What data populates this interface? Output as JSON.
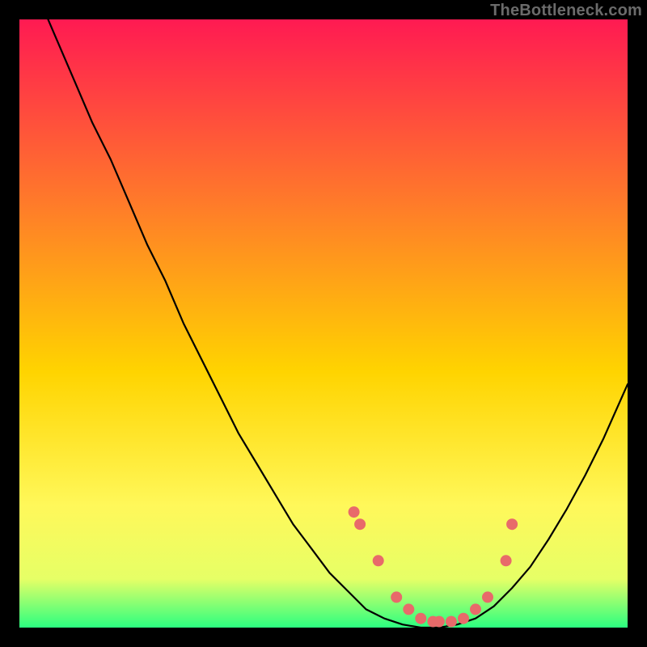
{
  "attribution": "TheBottleneck.com",
  "colors": {
    "gradient_top": "#ff1a52",
    "gradient_mid1": "#ff7a2a",
    "gradient_mid2": "#ffd400",
    "gradient_mid3": "#fff85a",
    "gradient_low": "#e6ff66",
    "gradient_bottom": "#2bff80",
    "curve": "#000000",
    "marker": "#e86a6a",
    "frame": "#000000"
  },
  "chart_data": {
    "type": "line",
    "title": "",
    "xlabel": "",
    "ylabel": "",
    "xlim": [
      0,
      100
    ],
    "ylim": [
      0,
      100
    ],
    "series": [
      {
        "name": "bottleneck-curve",
        "x": [
          0,
          3,
          6,
          9,
          12,
          15,
          18,
          21,
          24,
          27,
          30,
          33,
          36,
          39,
          42,
          45,
          48,
          51,
          54,
          57,
          60,
          63,
          66,
          69,
          72,
          75,
          78,
          81,
          84,
          87,
          90,
          93,
          96,
          100
        ],
        "y": [
          110,
          104,
          97,
          90,
          83,
          77,
          70,
          63,
          57,
          50,
          44,
          38,
          32,
          27,
          22,
          17,
          13,
          9,
          6,
          3,
          1.5,
          0.5,
          0,
          0,
          0.5,
          1.5,
          3.5,
          6.5,
          10,
          14.5,
          19.5,
          25,
          31,
          40
        ]
      }
    ],
    "markers": {
      "name": "highlight-points",
      "x": [
        55,
        56,
        59,
        62,
        64,
        66,
        68,
        69,
        71,
        73,
        75,
        77,
        80,
        81
      ],
      "y": [
        19,
        17,
        11,
        5,
        3,
        1.5,
        1,
        1,
        1,
        1.5,
        3,
        5,
        11,
        17
      ]
    }
  }
}
